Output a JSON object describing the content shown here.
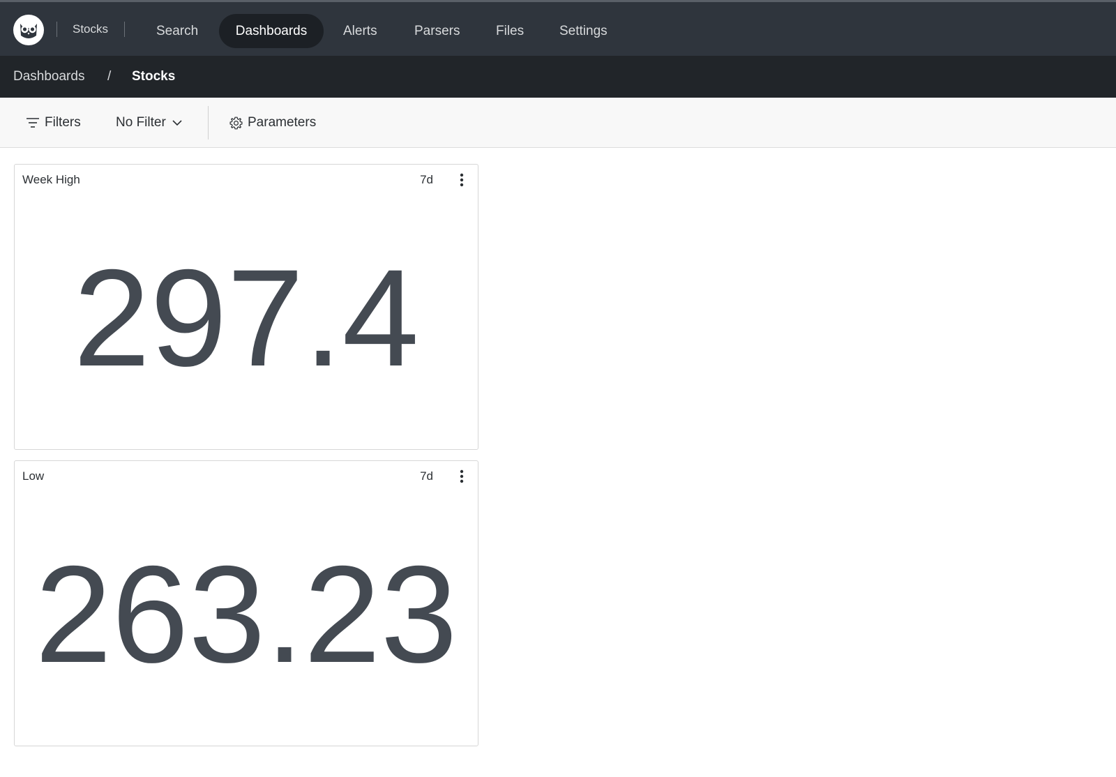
{
  "header": {
    "app_name": "Stocks",
    "logo_icon": "owl-logo-icon",
    "nav": [
      "Search",
      "Dashboards",
      "Alerts",
      "Parsers",
      "Files",
      "Settings"
    ],
    "active_nav": "Dashboards"
  },
  "breadcrumb": {
    "parent": "Dashboards",
    "separator": "/",
    "current": "Stocks"
  },
  "toolbar": {
    "filters_label": "Filters",
    "filters_icon": "filter-lines-icon",
    "filter_value": "No Filter",
    "filter_dropdown_icon": "chevron-down-icon",
    "parameters_label": "Parameters",
    "parameters_icon": "gear-icon"
  },
  "widgets": [
    {
      "title": "Week High",
      "range": "7d",
      "value": "297.4",
      "menu_icon": "kebab-menu-icon"
    },
    {
      "title": "Low",
      "range": "7d",
      "value": "263.23",
      "menu_icon": "kebab-menu-icon"
    }
  ],
  "colors": {
    "topbar": "#2f353d",
    "breadcrumb_bar": "#212529",
    "active_nav_pill": "#1c2025",
    "big_number": "#444a52"
  }
}
